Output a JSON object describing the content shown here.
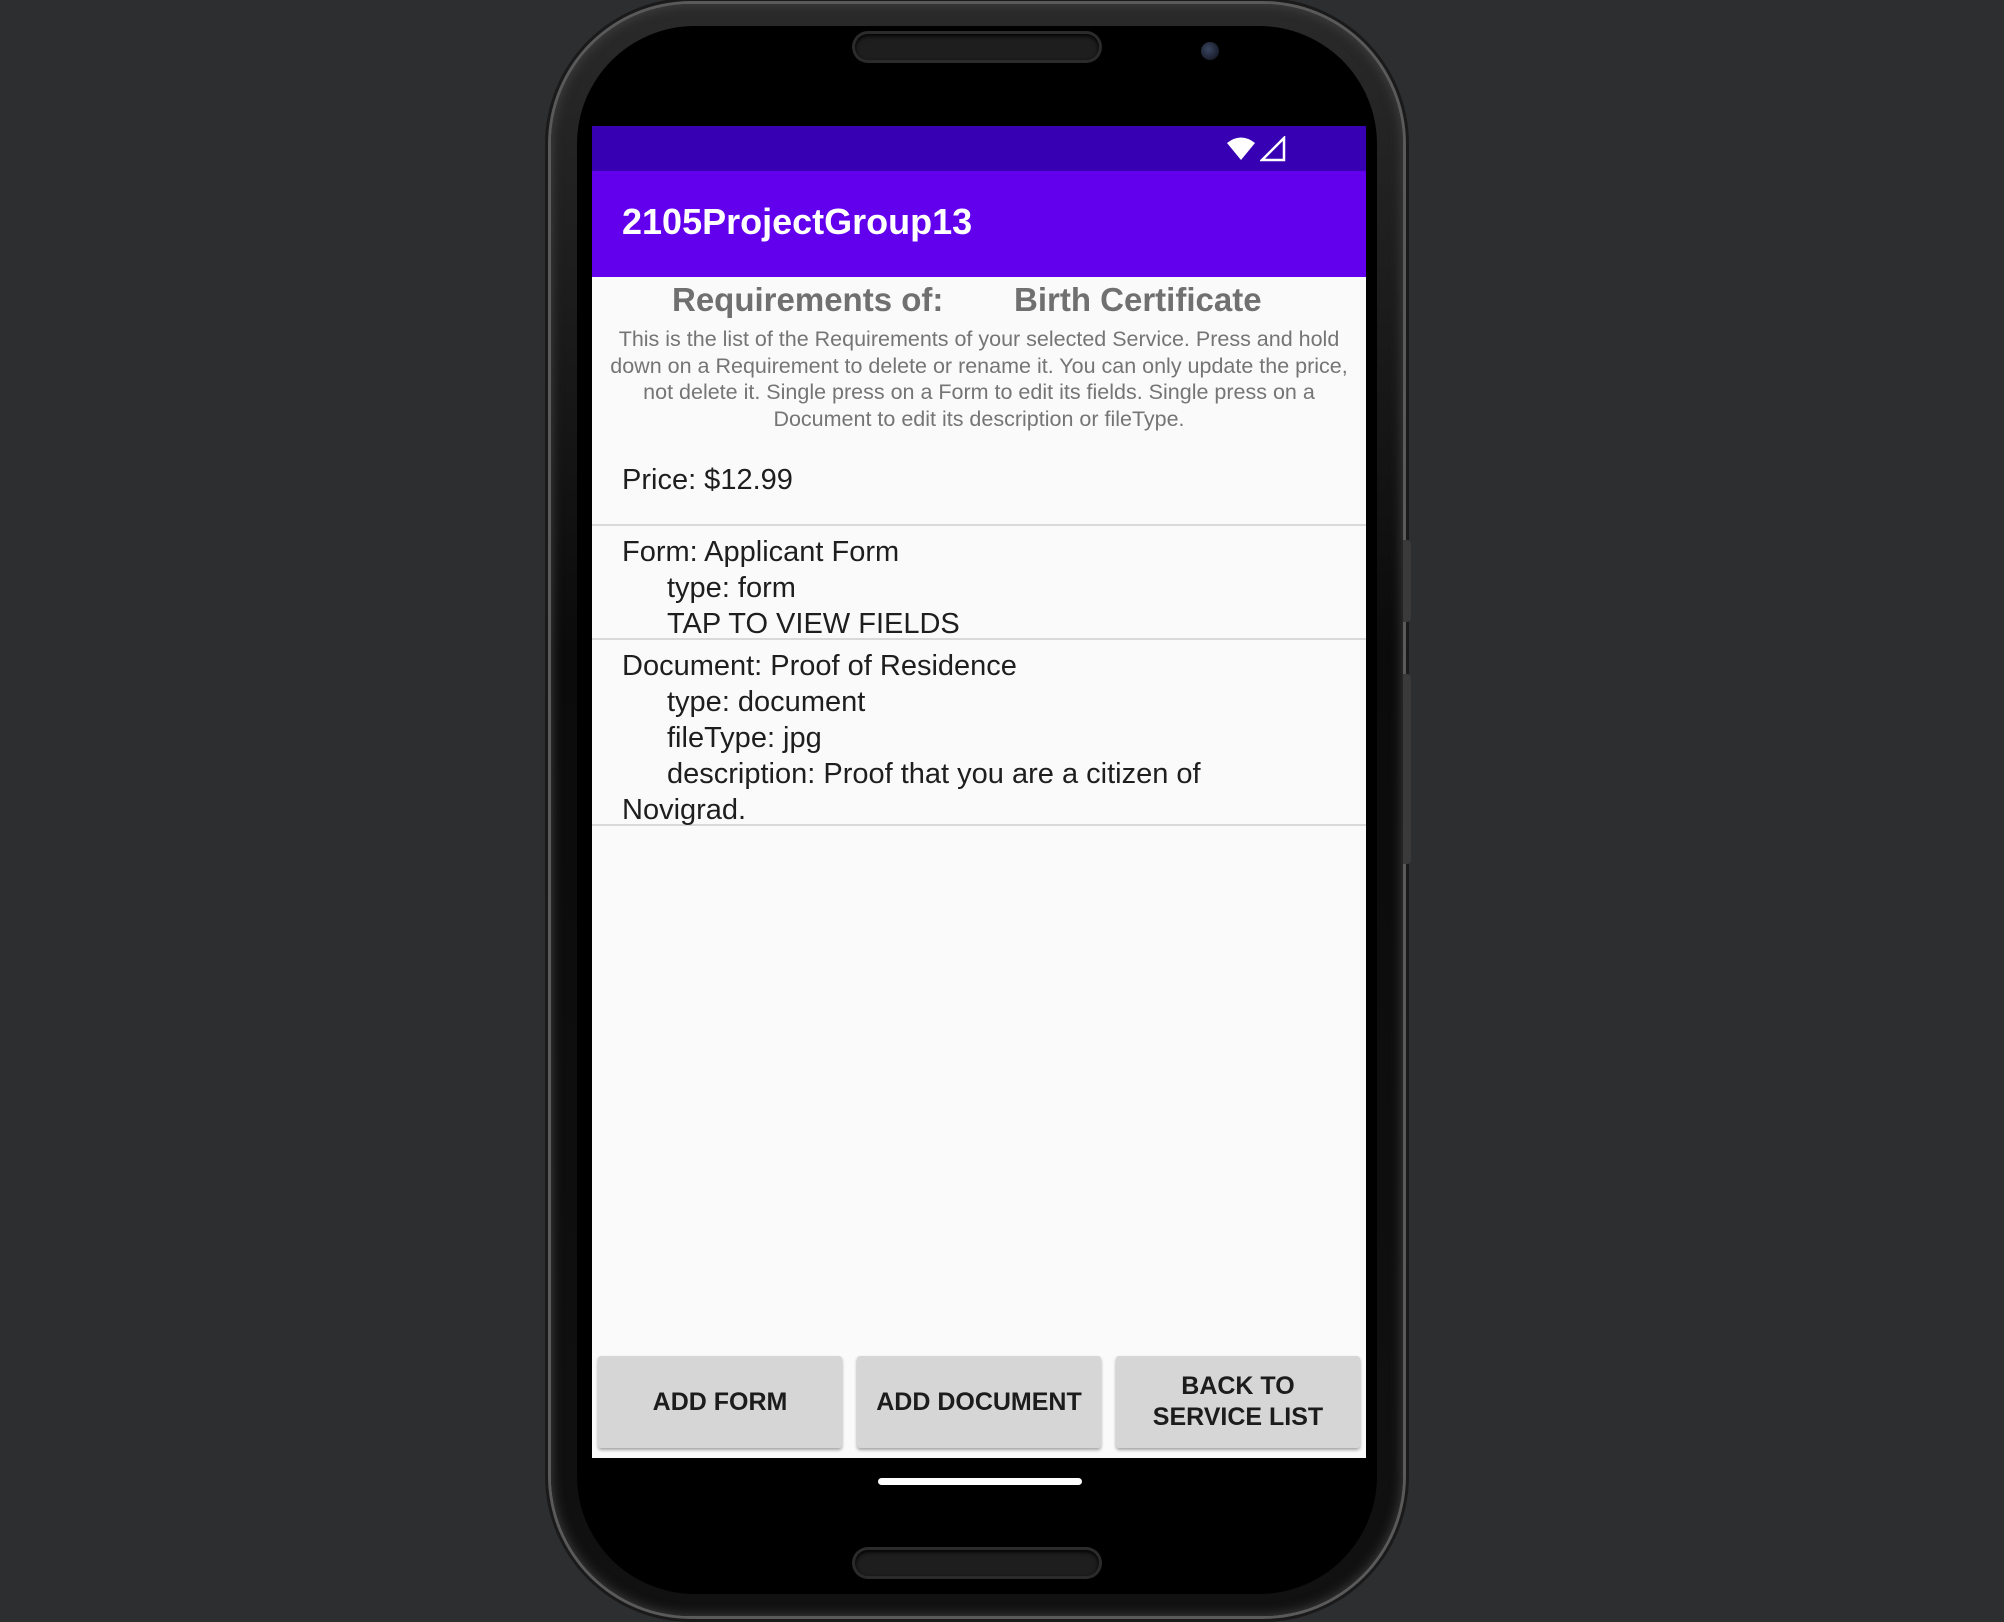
{
  "status_bar": {
    "wifi_icon": "wifi-icon",
    "signal_icon": "cellular-signal-icon"
  },
  "app_bar": {
    "title": "2105ProjectGroup13"
  },
  "header": {
    "requirements_label": "Requirements of:",
    "service_name": "Birth Certificate",
    "instructions": "This is the list of the Requirements of your selected Service. Press and hold down on a Requirement to delete or rename it. You can only update the price, not delete it. Single press on a Form to edit its fields. Single press on a Document to edit its description or fileType."
  },
  "requirements": {
    "price": "Price: $12.99",
    "form": {
      "name": "Form: Applicant Form",
      "type": "type: form",
      "action": "TAP TO VIEW FIELDS"
    },
    "document": {
      "name": "Document: Proof of Residence",
      "type": "type: document",
      "file_type": "fileType: jpg",
      "description_line1": "description: Proof that you are a citizen of",
      "description_line2": "Novigrad."
    }
  },
  "buttons": {
    "add_form": "ADD FORM",
    "add_document": "ADD DOCUMENT",
    "back_to_service_list_line1": "BACK TO",
    "back_to_service_list_line2": "SERVICE LIST"
  },
  "colors": {
    "status_bar": "#3700b3",
    "app_bar": "#6200ee",
    "background": "#fafafa",
    "button": "#d6d6d6"
  }
}
